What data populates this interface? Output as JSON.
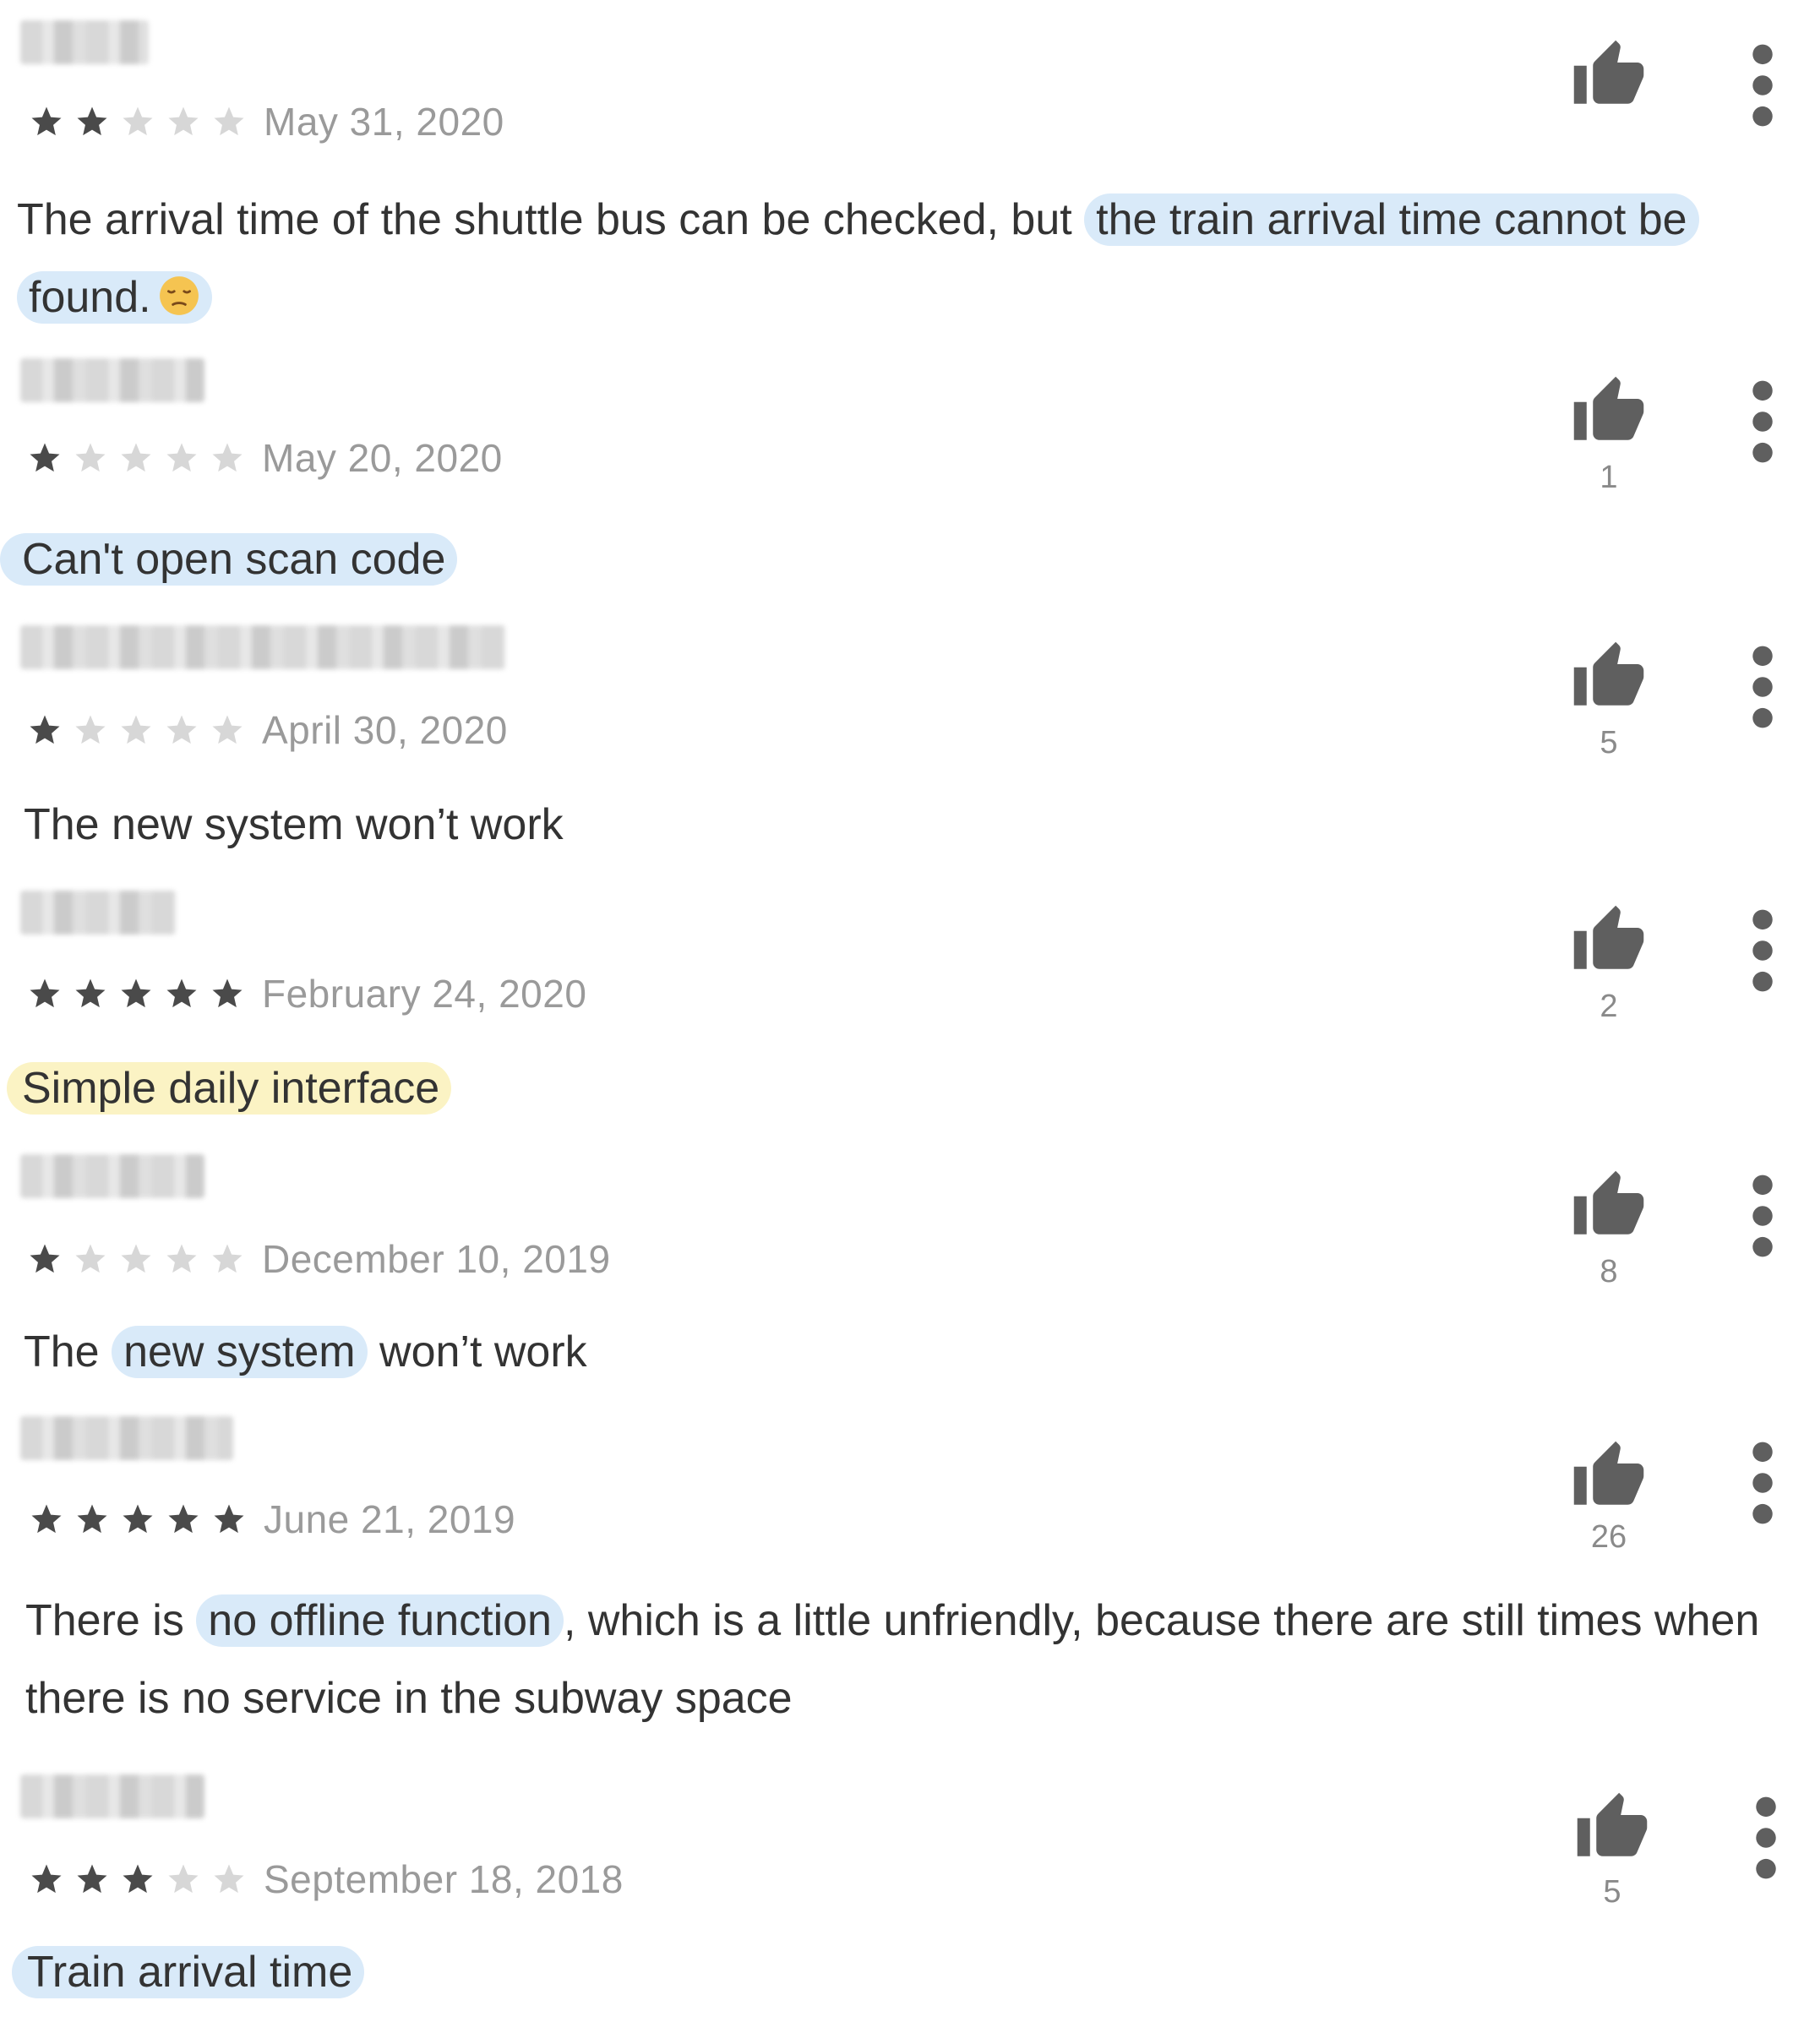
{
  "reviews": [
    {
      "author_redacted": true,
      "rating": 2,
      "date": "May 31, 2020",
      "helpful_count": "",
      "text": {
        "before": "The arrival time of the shuttle bus can be checked, but ",
        "highlight1": "the train arrival time cannot be",
        "highlight2": "found.",
        "after": ""
      }
    },
    {
      "author_redacted": true,
      "rating": 1,
      "date": "May 20, 2020",
      "helpful_count": "1",
      "text": {
        "highlight": "Can't open scan code"
      }
    },
    {
      "author_redacted": true,
      "rating": 1,
      "date": "April 30, 2020",
      "helpful_count": "5",
      "text": {
        "plain": "The new system won’t work"
      }
    },
    {
      "author_redacted": true,
      "rating": 5,
      "date": "February 24, 2020",
      "helpful_count": "2",
      "text": {
        "highlight": "Simple daily interface"
      }
    },
    {
      "author_redacted": true,
      "rating": 1,
      "date": "December 10, 2019",
      "helpful_count": "8",
      "text": {
        "before": "The ",
        "highlight": "new system",
        "after": " won’t work"
      }
    },
    {
      "author_redacted": true,
      "rating": 5,
      "date": "June 21, 2019",
      "helpful_count": "26",
      "text": {
        "before": "There is ",
        "highlight": "no offline function",
        "after": ", which is a little unfriendly, because there are still times when there is no service in the subway space"
      }
    },
    {
      "author_redacted": true,
      "rating": 3,
      "date": "September 18, 2018",
      "helpful_count": "5",
      "text": {
        "highlight": "Train arrival time"
      }
    }
  ],
  "colors": {
    "star_on": "#4a4a4a",
    "star_off": "#d7d7d7",
    "highlight_blue": "#d9eaf9",
    "highlight_yellow": "#fbf3c4",
    "date_text": "#9a9a9a"
  },
  "icons": {
    "thumb": "thumbs-up-icon",
    "more": "more-vert-icon",
    "star": "star-icon",
    "emoji": "pensive-face-emoji"
  }
}
